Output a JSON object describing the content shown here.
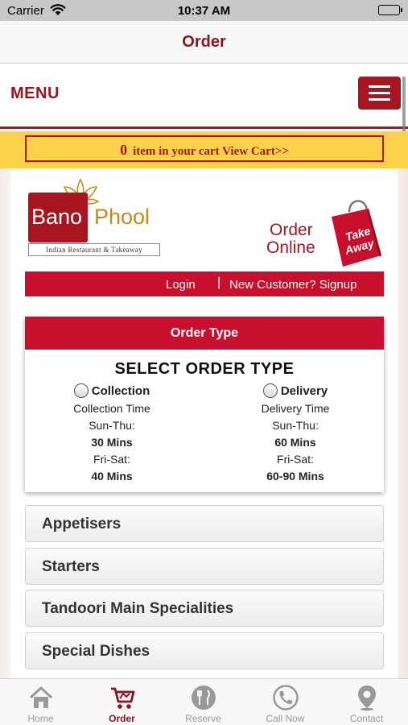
{
  "status_bar": {
    "carrier": "Carrier",
    "time": "10:37 AM"
  },
  "nav": {
    "title": "Order"
  },
  "site": {
    "menu_label": "MENU",
    "cart": {
      "count": "0",
      "text": "item in your cart View Cart>>"
    },
    "logo": {
      "name_part1": "Bano",
      "name_part2": "Phool",
      "tagline": "Indian Restaurant & Takeaway"
    },
    "order_online": {
      "line1": "Order",
      "line2": "Online",
      "badge_line1": "Take",
      "badge_line2": "Away"
    },
    "auth": {
      "login": "Login",
      "separator": "|",
      "signup": "New Customer? Signup"
    },
    "order_type": {
      "header": "Order Type",
      "title": "SELECT ORDER TYPE",
      "collection": {
        "label": "Collection",
        "time_label": "Collection Time",
        "sun_thu_label": "Sun-Thu:",
        "sun_thu_value": "30 Mins",
        "fri_sat_label": "Fri-Sat:",
        "fri_sat_value": "40 Mins"
      },
      "delivery": {
        "label": "Delivery",
        "time_label": "Delivery Time",
        "sun_thu_label": "Sun-Thu:",
        "sun_thu_value": "60 Mins",
        "fri_sat_label": "Fri-Sat:",
        "fri_sat_value": "60-90 Mins"
      }
    },
    "categories": [
      "Appetisers",
      "Starters",
      "Tandoori Main Specialities",
      "Special Dishes"
    ]
  },
  "tabs": [
    {
      "label": "Home",
      "icon": "home-icon",
      "active": false
    },
    {
      "label": "Order",
      "icon": "cart-icon",
      "active": true
    },
    {
      "label": "Reserve",
      "icon": "cutlery-icon",
      "active": false
    },
    {
      "label": "Call Now",
      "icon": "phone-icon",
      "active": false
    },
    {
      "label": "Contact",
      "icon": "location-pin-icon",
      "active": false
    }
  ],
  "colors": {
    "brand_red": "#a8141f",
    "accent_red": "#c8102e",
    "cart_yellow": "#fbd24a",
    "logo_gold": "#c68a1c"
  }
}
